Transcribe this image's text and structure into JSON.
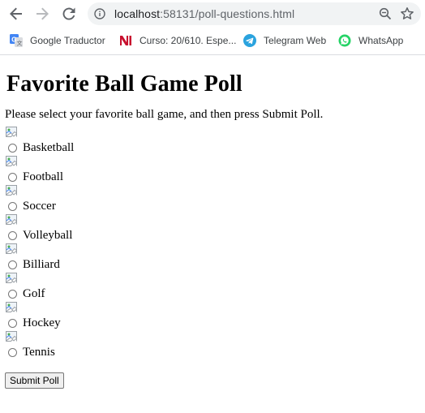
{
  "browser": {
    "url_host": "localhost",
    "url_rest": ":58131/poll-questions.html",
    "bookmarks": [
      {
        "label": "Google Traductor",
        "icon": "google-translate-icon"
      },
      {
        "label": "Curso: 20/610. Espe...",
        "icon": "ni-icon"
      },
      {
        "label": "Telegram Web",
        "icon": "telegram-icon"
      },
      {
        "label": "WhatsApp",
        "icon": "whatsapp-icon"
      }
    ]
  },
  "page": {
    "title": "Favorite Ball Game Poll",
    "intro": "Please select your favorite ball game, and then press Submit Poll.",
    "options": [
      {
        "label": "Basketball",
        "icon": "broken-image-icon"
      },
      {
        "label": "Football",
        "icon": "broken-image-icon"
      },
      {
        "label": "Soccer",
        "icon": "broken-image-icon"
      },
      {
        "label": "Volleyball",
        "icon": "broken-image-icon"
      },
      {
        "label": "Billiard",
        "icon": "broken-image-icon"
      },
      {
        "label": "Golf",
        "icon": "broken-image-icon"
      },
      {
        "label": "Hockey",
        "icon": "broken-image-icon"
      },
      {
        "label": "Tennis",
        "icon": "broken-image-icon"
      }
    ],
    "submit_label": "Submit Poll"
  },
  "colors": {
    "omnibox_bg": "#f1f3f4",
    "icon_gray": "#5f6368",
    "telegram": "#2aa3de",
    "whatsapp": "#25d366",
    "ni_red": "#c8102e"
  }
}
